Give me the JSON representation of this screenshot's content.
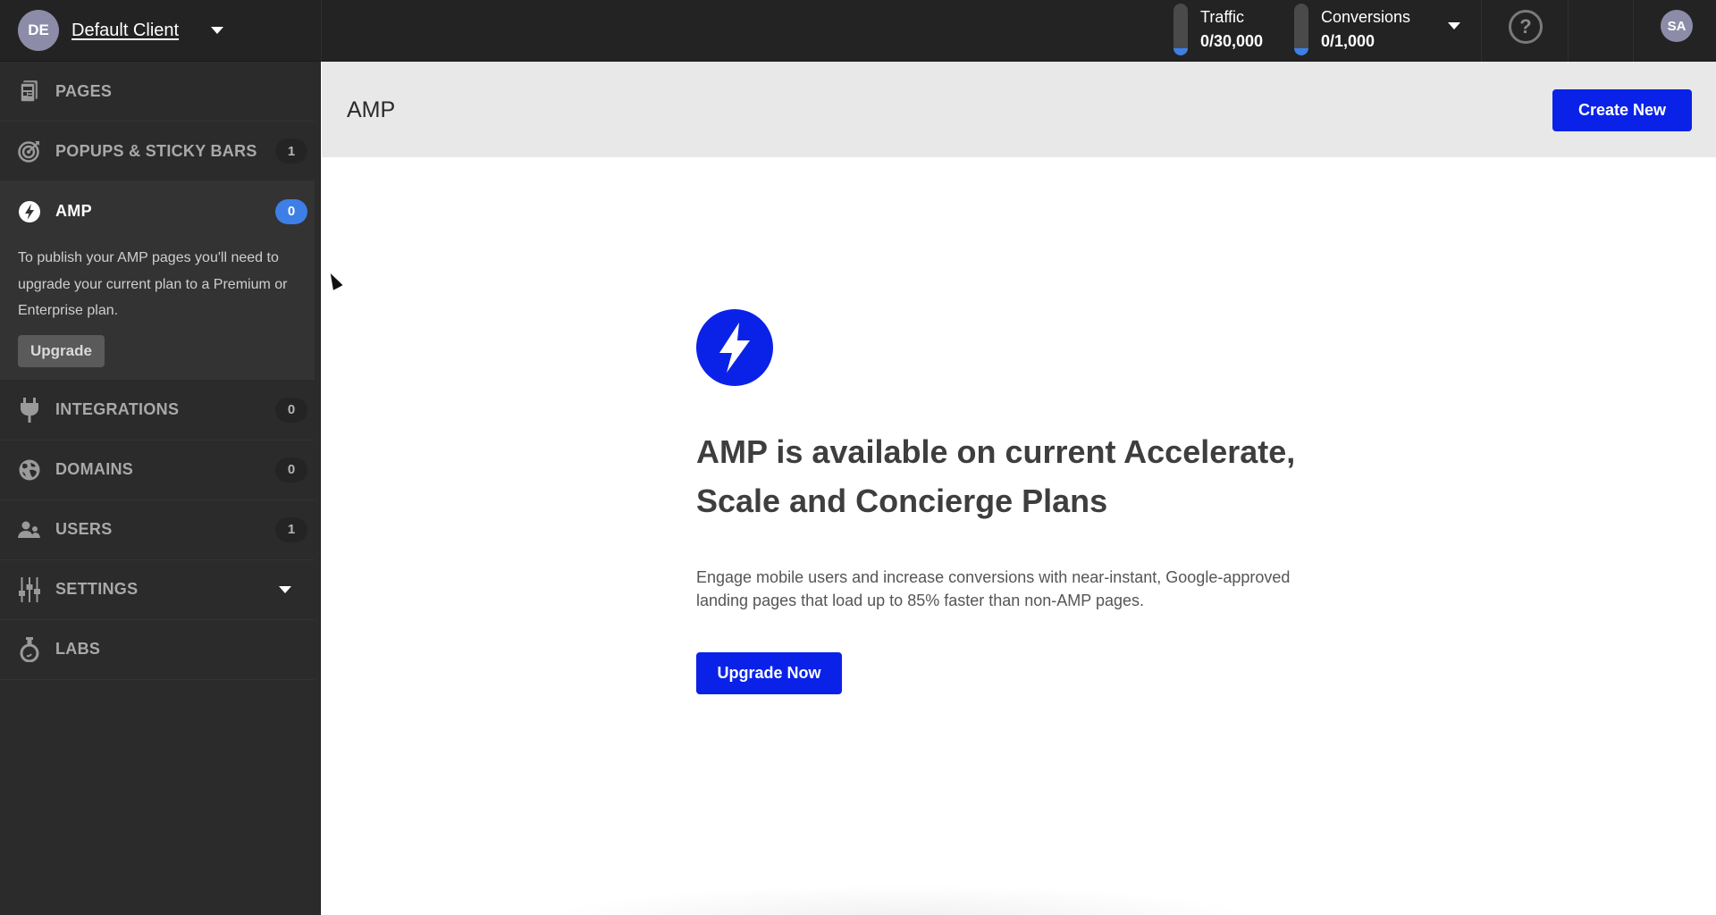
{
  "topbar": {
    "client_initials": "DE",
    "client_name": "Default Client",
    "traffic": {
      "label": "Traffic",
      "value": "0/30,000",
      "used_fraction": 0
    },
    "conversions": {
      "label": "Conversions",
      "value": "0/1,000",
      "used_fraction": 0
    },
    "help_glyph": "?",
    "user_initials": "SA"
  },
  "sidebar": {
    "items": [
      {
        "label": "PAGES",
        "icon": "pages-icon",
        "badge": null
      },
      {
        "label": "POPUPS & STICKY BARS",
        "icon": "target-icon",
        "badge": "1"
      },
      {
        "label": "AMP",
        "icon": "lightning-icon",
        "badge": "0",
        "active": true
      },
      {
        "label": "INTEGRATIONS",
        "icon": "plug-icon",
        "badge": "0"
      },
      {
        "label": "DOMAINS",
        "icon": "globe-icon",
        "badge": "0"
      },
      {
        "label": "USERS",
        "icon": "users-icon",
        "badge": "1"
      },
      {
        "label": "SETTINGS",
        "icon": "sliders-icon",
        "badge": null,
        "has_caret": true
      },
      {
        "label": "LABS",
        "icon": "flask-icon",
        "badge": null
      }
    ],
    "amp_panel": {
      "message": "To publish your AMP pages you'll need to upgrade your current plan to a Premium or Enterprise plan.",
      "button_label": "Upgrade"
    }
  },
  "main": {
    "title": "AMP",
    "create_button": "Create New",
    "headline": "AMP is available on current Accelerate, Scale and Concierge Plans",
    "description": "Engage mobile users and increase conversions with near-instant, Google-approved landing pages that load up to 85% faster than non-AMP pages.",
    "cta_button": "Upgrade Now"
  },
  "colors": {
    "accent_blue": "#0a22e8",
    "badge_blue": "#3d7fe6",
    "topbar_bg": "#232323",
    "sidebar_bg": "#2b2b2b",
    "header_bg": "#e8e8e8"
  }
}
